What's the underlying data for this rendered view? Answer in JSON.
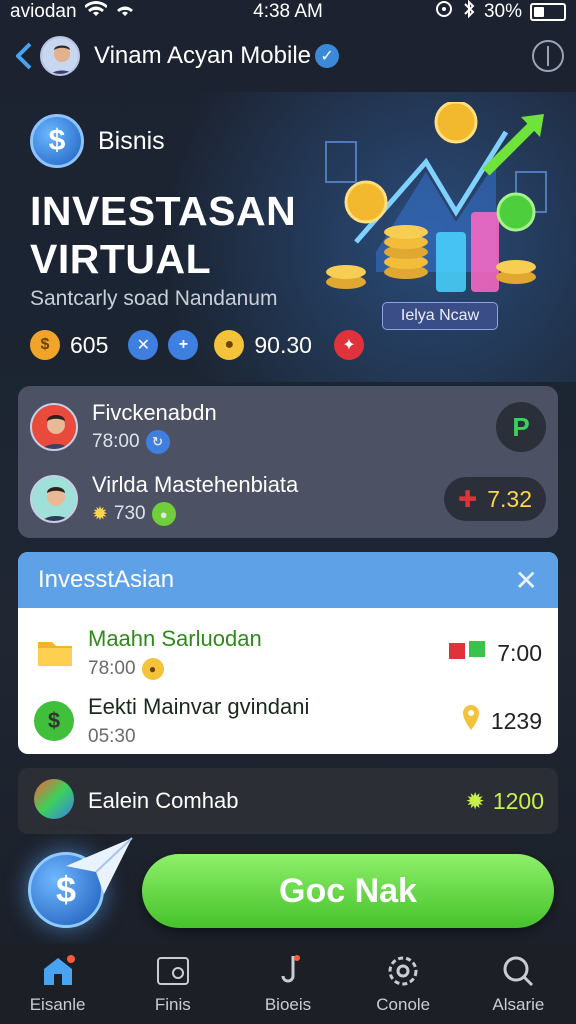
{
  "status_bar": {
    "carrier": "aviodan",
    "time": "4:38 AM",
    "battery": "30%",
    "battery_level": 0.3
  },
  "app_bar": {
    "title": "Vinam Acyan Mobile"
  },
  "hero": {
    "badge_label": "Bisnis",
    "title_line1": "INVESTASAN",
    "title_line2": "VIRTUAL",
    "subtitle": "Santcarly soad Nandanum",
    "learn_label": "Ielya Ncaw",
    "stat1": "605",
    "stat2": "90.30"
  },
  "accounts": [
    {
      "name": "Fivckenabdn",
      "meta": "78:00"
    },
    {
      "name": "Virlda Mastehenbiata",
      "meta": "730",
      "value": "7.32"
    }
  ],
  "invest": {
    "header": "InvesstAsian",
    "rows": [
      {
        "name": "Maahn Sarluodan",
        "meta": "78:00",
        "value": "7:00"
      },
      {
        "name": "Eekti Mainvar gvindani",
        "meta": "05:30",
        "value": "1239"
      }
    ]
  },
  "bottom_card": {
    "label": "Ealein Comhab",
    "value": "1200"
  },
  "go_button": {
    "label": "Goc Nak"
  },
  "nav": [
    {
      "label": "Eisanle",
      "icon": "home-icon"
    },
    {
      "label": "Finis",
      "icon": "image-icon"
    },
    {
      "label": "Bioeis",
      "icon": "tools-icon"
    },
    {
      "label": "Conole",
      "icon": "gear-icon"
    },
    {
      "label": "Alsarie",
      "icon": "search-icon"
    }
  ],
  "colors": {
    "accent": "#4aa3f0",
    "go": "#46c22b",
    "invest_header": "#5ea1e6"
  }
}
